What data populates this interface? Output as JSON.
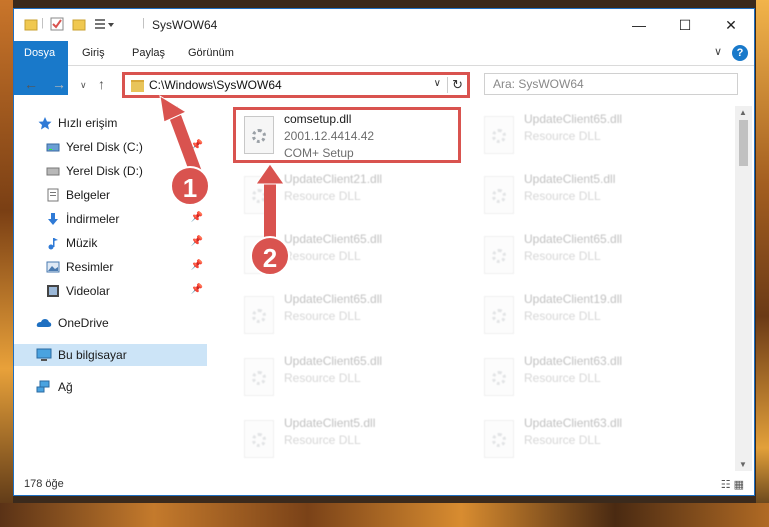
{
  "window": {
    "title": "SysWOW64"
  },
  "titlebar": {
    "minimize": "—",
    "maximize": "☐",
    "close": "✕"
  },
  "ribbon": {
    "tabs": [
      "Dosya",
      "Giriş",
      "Paylaş",
      "Görünüm"
    ],
    "help": "?",
    "expand": "∨"
  },
  "nav": {
    "back": "←",
    "forward": "→",
    "recent": "∨",
    "up": "↑",
    "address": "C:\\Windows\\SysWOW64",
    "dropdown": "∨",
    "refresh": "↻",
    "search_placeholder": "Ara: SysWOW64"
  },
  "sidebar": {
    "items": [
      {
        "label": "Hızlı erişim",
        "icon": "star-icon",
        "pinned": false
      },
      {
        "label": "Yerel Disk (C:)",
        "icon": "drive-icon",
        "pinned": true
      },
      {
        "label": "Yerel Disk (D:)",
        "icon": "drive-icon",
        "pinned": false
      },
      {
        "label": "Belgeler",
        "icon": "documents-icon",
        "pinned": true
      },
      {
        "label": "İndirmeler",
        "icon": "download-icon",
        "pinned": true
      },
      {
        "label": "Müzik",
        "icon": "music-icon",
        "pinned": true
      },
      {
        "label": "Resimler",
        "icon": "pictures-icon",
        "pinned": true
      },
      {
        "label": "Videolar",
        "icon": "video-icon",
        "pinned": true
      },
      {
        "label": "OneDrive",
        "icon": "cloud-icon",
        "pinned": false
      },
      {
        "label": "Bu bilgisayar",
        "icon": "computer-icon",
        "pinned": false
      },
      {
        "label": "Ağ",
        "icon": "network-icon",
        "pinned": false
      }
    ],
    "pin_glyph": "📌"
  },
  "files": {
    "main": {
      "name": "comsetup.dll",
      "version": "2001.12.4414.42",
      "desc": "COM+ Setup"
    },
    "ghosts": [
      {
        "name": "UpdateClient65.dll",
        "desc": "Resource DLL"
      },
      {
        "name": "UpdateClient21.dll",
        "desc": "Resource DLL"
      },
      {
        "name": "UpdateClient5.dll",
        "desc": "Resource DLL"
      },
      {
        "name": "UpdateClient65.dll",
        "desc": "Resource DLL"
      },
      {
        "name": "UpdateClient65.dll",
        "desc": "Resource DLL"
      },
      {
        "name": "UpdateClient65.dll",
        "desc": "Resource DLL"
      },
      {
        "name": "UpdateClient19.dll",
        "desc": "Resource DLL"
      },
      {
        "name": "UpdateClient65.dll",
        "desc": "Resource DLL"
      },
      {
        "name": "UpdateClient63.dll",
        "desc": "Resource DLL"
      },
      {
        "name": "UpdateClient5.dll",
        "desc": "Resource DLL"
      },
      {
        "name": "UpdateClient63.dll",
        "desc": "Resource DLL"
      }
    ]
  },
  "status": {
    "count": "178 öğe",
    "views": "☷ ▦"
  },
  "annotations": {
    "step1": "1",
    "step2": "2",
    "color": "#d9534f"
  }
}
